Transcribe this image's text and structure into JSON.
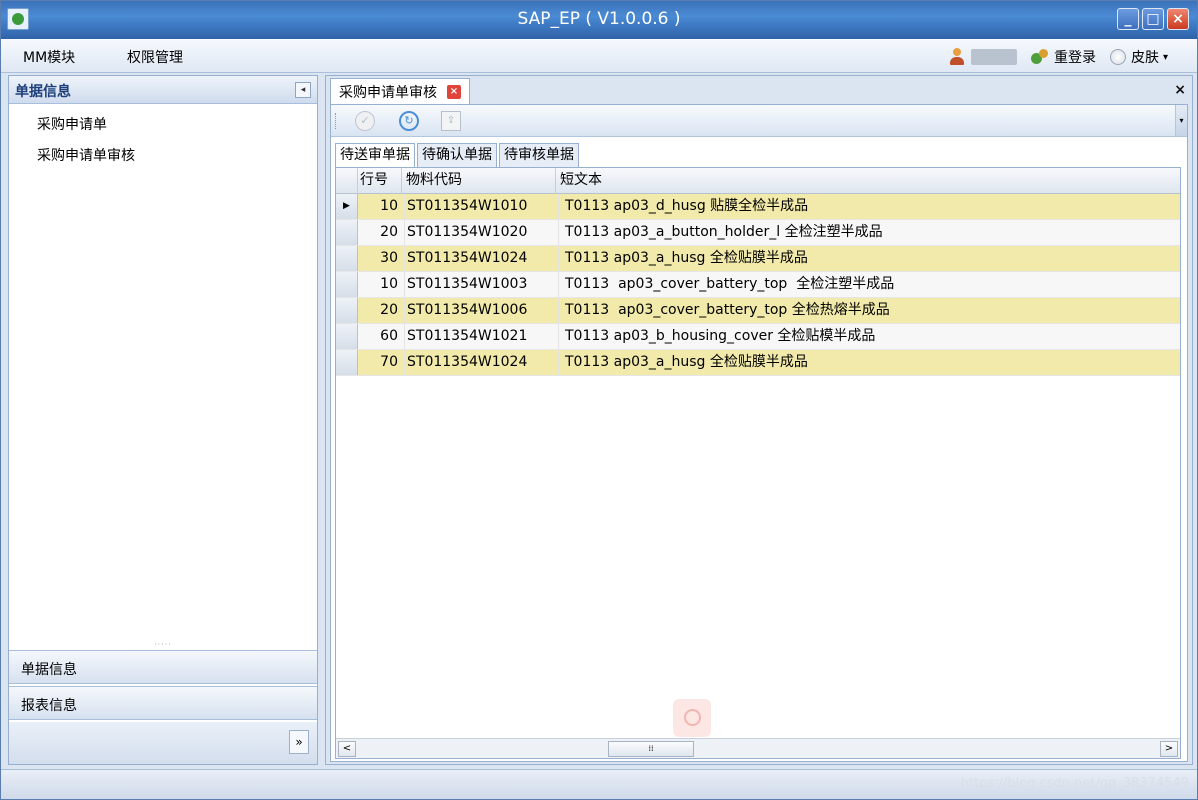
{
  "window": {
    "title": "SAP_EP ( V1.0.0.6 )",
    "minimize_glyph": "_",
    "maximize_glyph": "□",
    "close_glyph": "×"
  },
  "menu": {
    "items": [
      "MM模块",
      "权限管理"
    ],
    "relogin_label": "重登录",
    "skin_label": "皮肤",
    "skin_caret": "▾"
  },
  "sidebar": {
    "header_title": "单据信息",
    "collapse_glyph": "◂",
    "items": [
      "采购申请单",
      "采购申请单审核"
    ],
    "splitter": "·····",
    "sections": [
      "单据信息",
      "报表信息"
    ],
    "expand_glyph": "»"
  },
  "document_tab": {
    "label": "采购申请单审核",
    "close_glyph": "×",
    "panel_close_glyph": "×"
  },
  "toolbar": {
    "approve_glyph": "✓",
    "refresh_glyph": "↻",
    "export_glyph": "⇪",
    "overflow_glyph": "▾"
  },
  "subtabs": [
    "待送审单据",
    "待确认单据",
    "待审核单据"
  ],
  "grid": {
    "columns": [
      "行号",
      "物料代码",
      "短文本"
    ],
    "current_row_glyph": "▶",
    "rows": [
      {
        "line": "10",
        "code": "ST011354W1010",
        "text": "T0113 ap03_d_husg 贴膜全检半成品"
      },
      {
        "line": "20",
        "code": "ST011354W1020",
        "text": "T0113 ap03_a_button_holder_l 全检注塑半成品"
      },
      {
        "line": "30",
        "code": "ST011354W1024",
        "text": "T0113 ap03_a_husg 全检贴膜半成品"
      },
      {
        "line": "10",
        "code": "ST011354W1003",
        "text": "T0113  ap03_cover_battery_top  全检注塑半成品"
      },
      {
        "line": "20",
        "code": "ST011354W1006",
        "text": "T0113  ap03_cover_battery_top 全检热熔半成品"
      },
      {
        "line": "60",
        "code": "ST011354W1021",
        "text": "T0113 ap03_b_housing_cover 全检贴模半成品"
      },
      {
        "line": "70",
        "code": "ST011354W1024",
        "text": "T0113 ap03_a_husg 全检贴膜半成品"
      }
    ],
    "scroll_left": "<",
    "scroll_right": ">",
    "scroll_thumb": "⁞⁞"
  },
  "status": {
    "watermark": "https://blog.csdn.net/qq_38374549"
  },
  "colors": {
    "row_highlight": "#f2eaaa",
    "title_bar": "#3f7cc6"
  }
}
